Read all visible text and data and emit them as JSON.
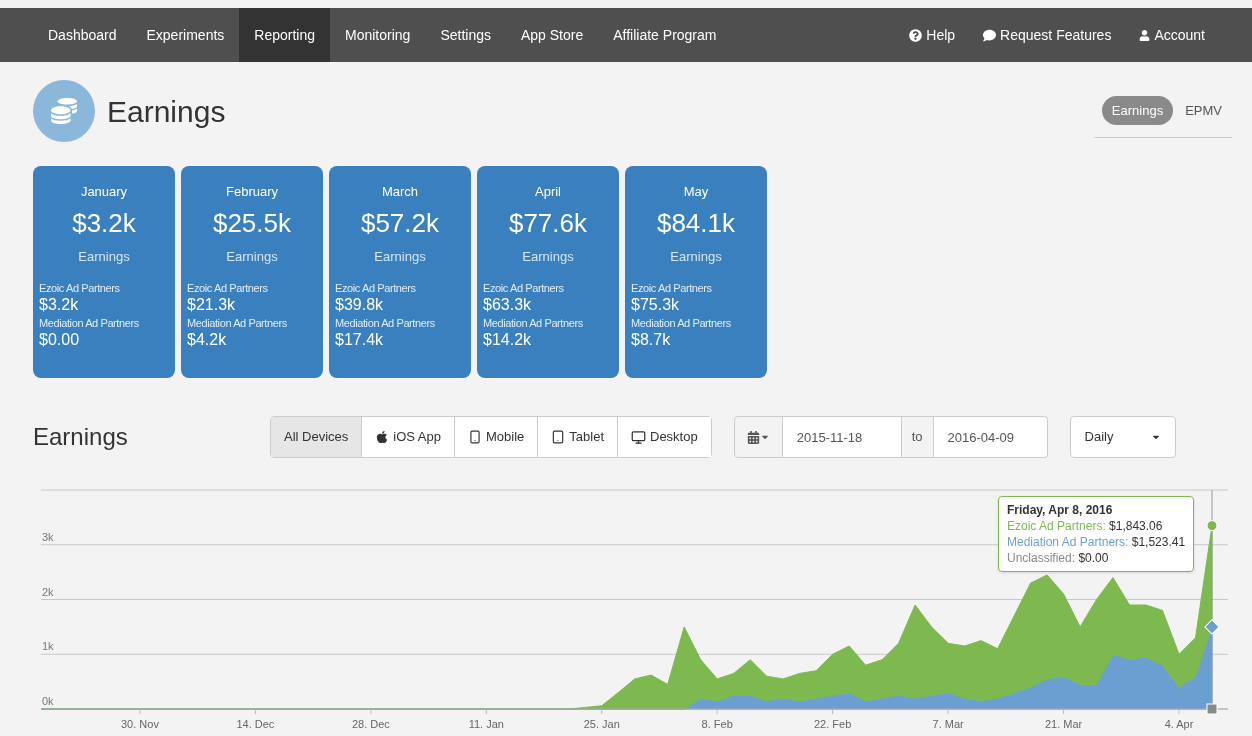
{
  "nav": {
    "items": [
      {
        "label": "Dashboard",
        "selected": false
      },
      {
        "label": "Experiments",
        "selected": false
      },
      {
        "label": "Reporting",
        "selected": true
      },
      {
        "label": "Monitoring",
        "selected": false
      },
      {
        "label": "Settings",
        "selected": false
      },
      {
        "label": "App Store",
        "selected": false
      },
      {
        "label": "Affiliate Program",
        "selected": false
      }
    ],
    "right": [
      {
        "label": "Help",
        "kind": "help"
      },
      {
        "label": "Request Features",
        "kind": "comment"
      },
      {
        "label": "Account",
        "kind": "user"
      }
    ]
  },
  "header": {
    "title": "Earnings",
    "views": [
      {
        "label": "Earnings",
        "selected": true
      },
      {
        "label": "EPMV",
        "selected": false
      }
    ]
  },
  "cards": [
    {
      "month": "January",
      "total": "$3.2k",
      "total_label": "Earnings",
      "rows": [
        {
          "label": "Ezoic Ad Partners",
          "value": "$3.2k"
        },
        {
          "label": "Mediation Ad Partners",
          "value": "$0.00"
        }
      ]
    },
    {
      "month": "February",
      "total": "$25.5k",
      "total_label": "Earnings",
      "rows": [
        {
          "label": "Ezoic Ad Partners",
          "value": "$21.3k"
        },
        {
          "label": "Mediation Ad Partners",
          "value": "$4.2k"
        }
      ]
    },
    {
      "month": "March",
      "total": "$57.2k",
      "total_label": "Earnings",
      "rows": [
        {
          "label": "Ezoic Ad Partners",
          "value": "$39.8k"
        },
        {
          "label": "Mediation Ad Partners",
          "value": "$17.4k"
        }
      ]
    },
    {
      "month": "April",
      "total": "$77.6k",
      "total_label": "Earnings",
      "rows": [
        {
          "label": "Ezoic Ad Partners",
          "value": "$63.3k"
        },
        {
          "label": "Mediation Ad Partners",
          "value": "$14.2k"
        }
      ]
    },
    {
      "month": "May",
      "total": "$84.1k",
      "total_label": "Earnings",
      "rows": [
        {
          "label": "Ezoic Ad Partners",
          "value": "$75.3k"
        },
        {
          "label": "Mediation Ad Partners",
          "value": "$8.7k"
        }
      ]
    }
  ],
  "report": {
    "title": "Earnings",
    "devices": [
      {
        "label": "All Devices",
        "kind": "all",
        "selected": true
      },
      {
        "label": "iOS App",
        "kind": "apple",
        "selected": false
      },
      {
        "label": "Mobile",
        "kind": "mobile",
        "selected": false
      },
      {
        "label": "Tablet",
        "kind": "tablet",
        "selected": false
      },
      {
        "label": "Desktop",
        "kind": "desktop",
        "selected": false
      }
    ],
    "date_range": {
      "from": "2015-11-18",
      "separator": "to",
      "to": "2016-04-09"
    },
    "interval": {
      "value": "Daily"
    },
    "chart_data": {
      "type": "area",
      "stacked": true,
      "categories": [
        null,
        null,
        null,
        null,
        null,
        null,
        "30. Nov",
        null,
        null,
        null,
        null,
        null,
        null,
        "14. Dec",
        null,
        null,
        null,
        null,
        null,
        null,
        "28. Dec",
        null,
        null,
        null,
        null,
        null,
        null,
        "11. Jan",
        null,
        null,
        null,
        null,
        null,
        null,
        "25. Jan",
        null,
        null,
        null,
        null,
        null,
        null,
        "8. Feb",
        null,
        null,
        null,
        null,
        null,
        null,
        "22. Feb",
        null,
        null,
        null,
        null,
        null,
        null,
        "7. Mar",
        null,
        null,
        null,
        null,
        null,
        null,
        "21. Mar",
        null,
        null,
        null,
        null,
        null,
        null,
        "4. Apr",
        null,
        null
      ],
      "series": [
        {
          "color": "#6b9fd1",
          "values": [
            0,
            0,
            0,
            0,
            0,
            0,
            0,
            0,
            0,
            0,
            0,
            0,
            0,
            0,
            0,
            0,
            0,
            0,
            0,
            0,
            0,
            0,
            0,
            0,
            0,
            0,
            0,
            0,
            0,
            0,
            0,
            0,
            0,
            0,
            0,
            0,
            0,
            0,
            0,
            0,
            200,
            150,
            250,
            250,
            150,
            200,
            150,
            200,
            250,
            300,
            150,
            200,
            250,
            200,
            250,
            300,
            200,
            150,
            200,
            300,
            400,
            550,
            600,
            450,
            450,
            1000,
            900,
            950,
            800,
            400,
            600,
            1500
          ]
        },
        {
          "color": "#7db94f",
          "values": [
            0,
            0,
            0,
            0,
            0,
            0,
            0,
            0,
            0,
            0,
            0,
            0,
            0,
            0,
            0,
            0,
            0,
            0,
            0,
            0,
            0,
            0,
            0,
            0,
            0,
            0,
            0,
            0,
            0,
            0,
            0,
            0,
            0,
            30,
            60,
            300,
            550,
            620,
            450,
            1500,
            700,
            400,
            400,
            650,
            450,
            350,
            500,
            500,
            750,
            850,
            650,
            700,
            950,
            1700,
            1250,
            900,
            950,
            1100,
            900,
            1400,
            1900,
            1900,
            1500,
            1050,
            1550,
            1400,
            1000,
            950,
            1000,
            600,
            700,
            1850
          ]
        }
      ],
      "ylim": [
        0,
        4000
      ],
      "grid": true,
      "yticks": [
        {
          "value": 0,
          "label": "0k"
        },
        {
          "value": 1000,
          "label": "1k"
        },
        {
          "value": 2000,
          "label": "2k"
        },
        {
          "value": 3000,
          "label": "3k"
        }
      ]
    },
    "tooltip": {
      "title": "Friday, Apr 8, 2016",
      "lines": [
        {
          "label": "Ezoic Ad Partners:",
          "value": "$1,843.06",
          "color": "#7db94f"
        },
        {
          "label": "Mediation Ad Partners:",
          "value": "$1,523.41",
          "color": "#6b9fd1"
        },
        {
          "label": "Unclassified:",
          "value": "$0.00",
          "color": "#8a8a8a"
        }
      ]
    }
  }
}
